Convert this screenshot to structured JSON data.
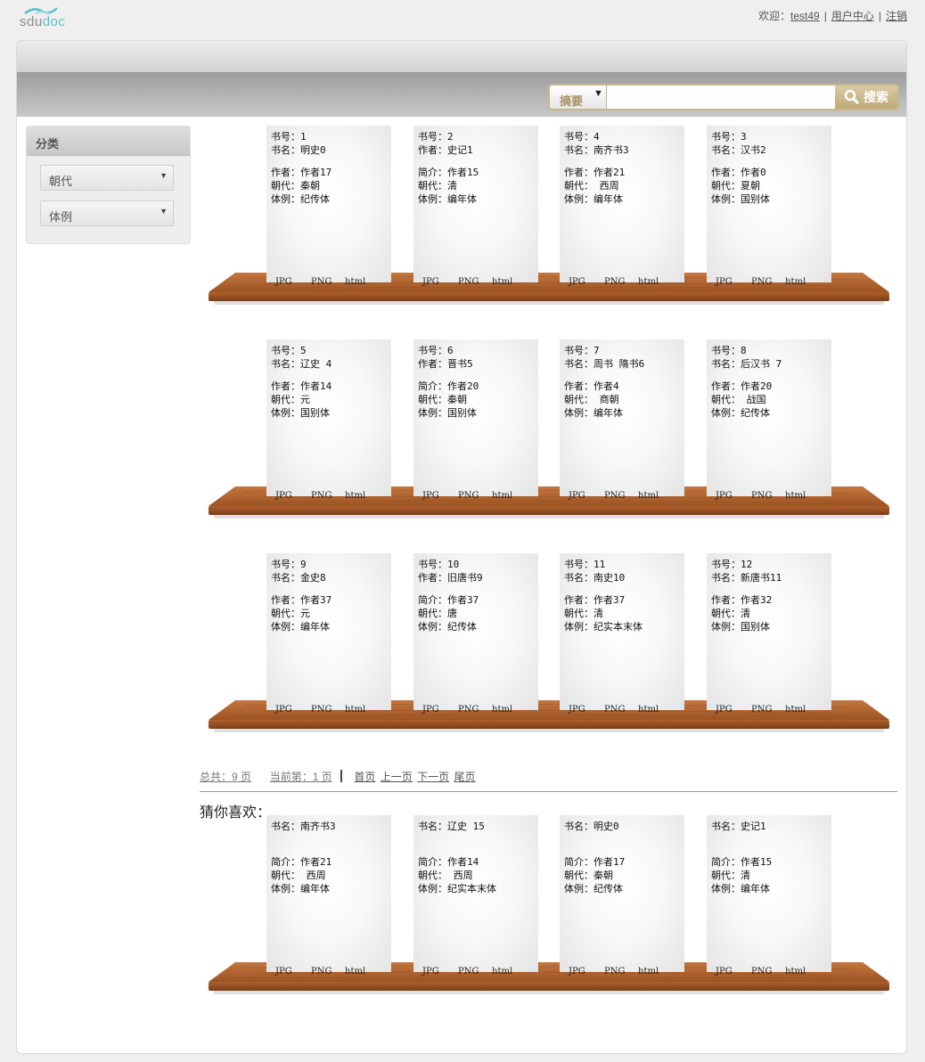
{
  "brand": {
    "logo_text_a": "sdu",
    "logo_text_b": "doc"
  },
  "top_nav": {
    "welcome": "欢迎：",
    "username": "test49",
    "user_center": "用户中心",
    "logout": "注销",
    "sep": "|"
  },
  "search": {
    "field_label": "摘要",
    "dropdown_arrow": "▼",
    "value": "",
    "placeholder": "",
    "button_label": "搜索",
    "icon": "search-icon"
  },
  "sidebar": {
    "title": "分类",
    "filters": [
      {
        "label": "朝代"
      },
      {
        "label": "体例"
      }
    ]
  },
  "book_labels": {
    "id": "书号：",
    "name": "书名：",
    "author": "作者：",
    "intro": "简介：",
    "dynasty": "朝代：",
    "style": "体例："
  },
  "formats": [
    "JPG",
    "PNG",
    "html"
  ],
  "books": [
    {
      "id": "1",
      "name": "明史0",
      "second_label": "作者：",
      "second": "作者17",
      "dynasty": "秦朝",
      "style": "纪传体"
    },
    {
      "id": "2",
      "name": "史记1",
      "name_label": "作者：",
      "second_label": "简介：",
      "second": "作者15",
      "dynasty": "清",
      "style": "编年体"
    },
    {
      "id": "4",
      "name": "南齐书3",
      "second_label": "作者：",
      "second": "作者21",
      "dynasty": " 西周",
      "style": "编年体"
    },
    {
      "id": "3",
      "name": "汉书2",
      "second_label": "作者：",
      "second": "作者0",
      "dynasty": "夏朝",
      "style": "国别体"
    },
    {
      "id": "5",
      "name": "辽史 4",
      "second_label": "作者：",
      "second": "作者14",
      "dynasty": "元",
      "style": "国别体"
    },
    {
      "id": "6",
      "name": "晋书5",
      "name_label": "作者：",
      "second_label": "简介：",
      "second": "作者20",
      "dynasty": "秦朝",
      "style": "国别体"
    },
    {
      "id": "7",
      "name": "周书 隋书6",
      "second_label": "作者：",
      "second": "作者4",
      "dynasty": " 商朝",
      "style": "编年体"
    },
    {
      "id": "8",
      "name": "后汉书 7",
      "second_label": "作者：",
      "second": "作者20",
      "dynasty": " 战国",
      "style": "纪传体"
    },
    {
      "id": "9",
      "name": "金史8",
      "second_label": "作者：",
      "second": "作者37",
      "dynasty": "元",
      "style": "编年体"
    },
    {
      "id": "10",
      "name": "旧唐书9",
      "name_label": "作者：",
      "second_label": "简介：",
      "second": "作者37",
      "dynasty": "唐",
      "style": "纪传体"
    },
    {
      "id": "11",
      "name": "南史10",
      "second_label": "作者：",
      "second": "作者37",
      "dynasty": "清",
      "style": "纪实本末体"
    },
    {
      "id": "12",
      "name": "新唐书11",
      "second_label": "作者：",
      "second": "作者32",
      "dynasty": "清",
      "style": "国别体"
    }
  ],
  "pager": {
    "total": "总共：9 页",
    "current": "当前第：1 页",
    "first": "首页",
    "prev": "上一页",
    "next": "下一页",
    "last": "尾页"
  },
  "guess": {
    "title": "猜你喜欢：",
    "books": [
      {
        "name": "南齐书3",
        "intro": "作者21",
        "dynasty": " 西周",
        "style": "编年体"
      },
      {
        "name": "辽史 15",
        "intro": "作者14",
        "dynasty": " 西周",
        "style": "纪实本末体"
      },
      {
        "name": "明史0",
        "intro": "作者17",
        "dynasty": "秦朝",
        "style": "纪传体"
      },
      {
        "name": "史记1",
        "intro": "作者15",
        "dynasty": "清",
        "style": "编年体"
      }
    ]
  }
}
